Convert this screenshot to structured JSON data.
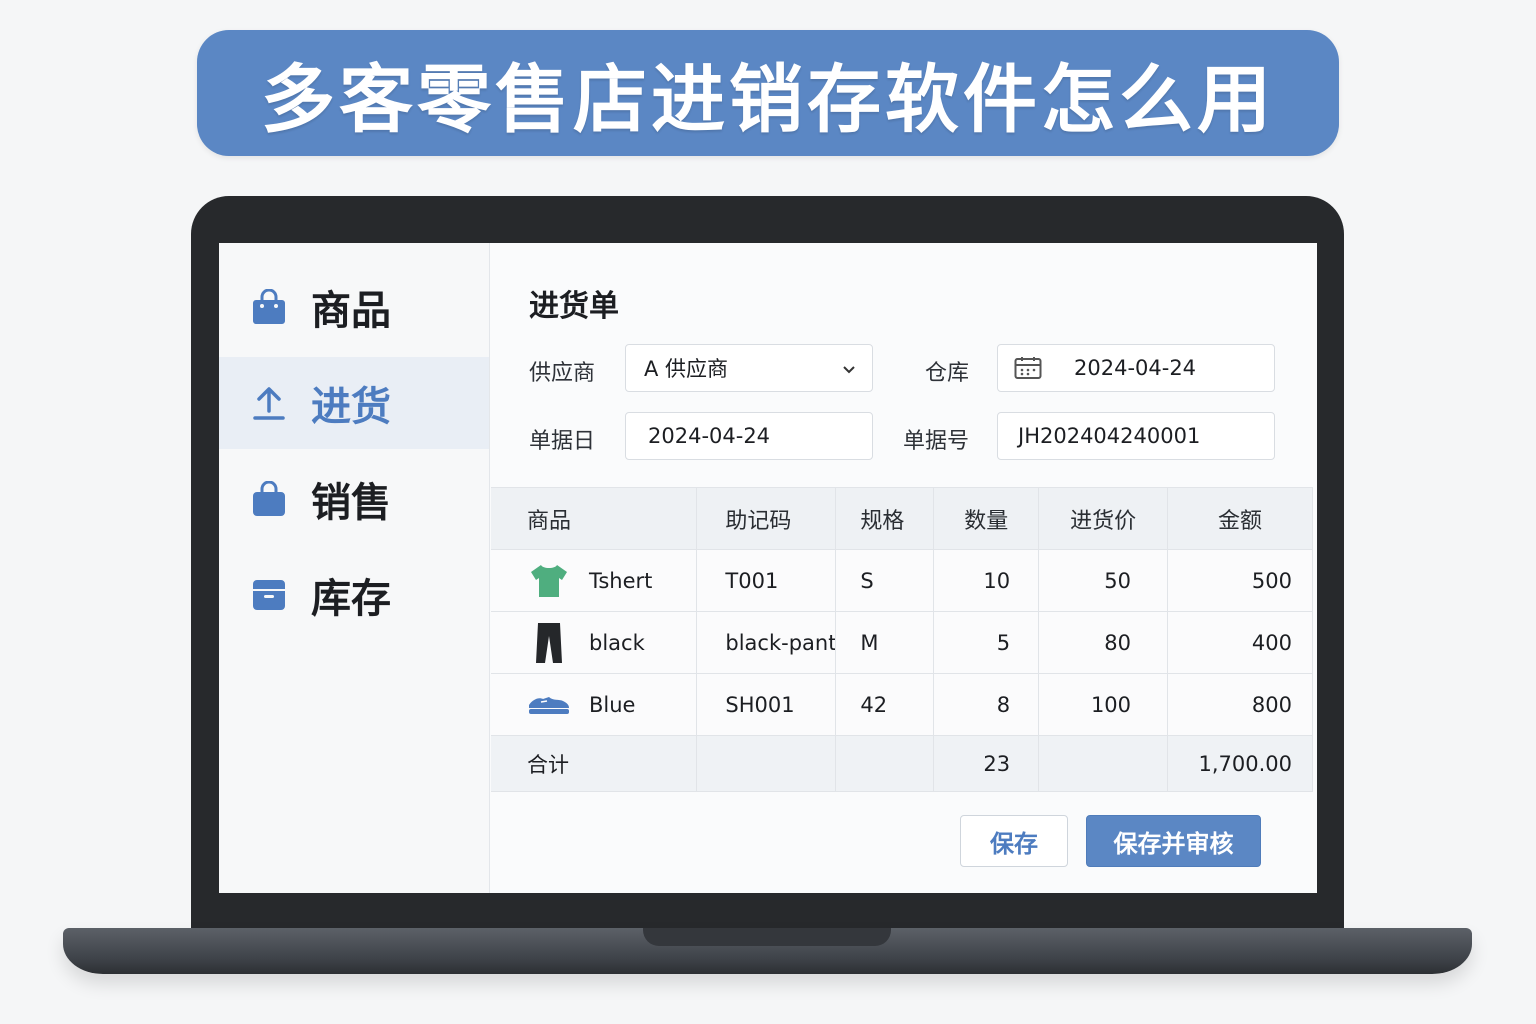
{
  "banner": {
    "title": "多客零售店进销存软件怎么用"
  },
  "sidebar": {
    "items": [
      {
        "label": "商品",
        "icon": "shopping-bag-icon",
        "active": false
      },
      {
        "label": "进货",
        "icon": "upload-icon",
        "active": true
      },
      {
        "label": "销售",
        "icon": "bag-icon",
        "active": false
      },
      {
        "label": "库存",
        "icon": "archive-box-icon",
        "active": false
      }
    ]
  },
  "main": {
    "title": "进货单",
    "form": {
      "supplier_label": "供应商",
      "supplier_value": "A 供应商",
      "warehouse_label": "仓库",
      "warehouse_value": "2024-04-24",
      "date_label": "单据日",
      "date_value": "2024-04-24",
      "doc_no_label": "单据号",
      "doc_no_value": "JH202404240001"
    },
    "table": {
      "headers": [
        "商品",
        "助记码",
        "规格",
        "数量",
        "进货价",
        "金额"
      ],
      "rows": [
        {
          "icon": "tshirt-icon",
          "name": "Tshert",
          "code": "T001",
          "spec": "S",
          "qty": "10",
          "price": "50",
          "amount": "500"
        },
        {
          "icon": "pants-icon",
          "name": "black",
          "code": "black-pants",
          "spec": "M",
          "qty": "5",
          "price": "80",
          "amount": "400"
        },
        {
          "icon": "shoe-icon",
          "name": "Blue",
          "code": "SH001",
          "spec": "42",
          "qty": "8",
          "price": "100",
          "amount": "800"
        }
      ],
      "total": {
        "label": "合计",
        "qty": "23",
        "amount": "1,700.00"
      }
    },
    "buttons": {
      "save": "保存",
      "save_and_audit": "保存并审核"
    }
  },
  "colors": {
    "accent": "#5b87c4",
    "active_text": "#4d7cc0",
    "tshirt": "#4fae7f"
  }
}
